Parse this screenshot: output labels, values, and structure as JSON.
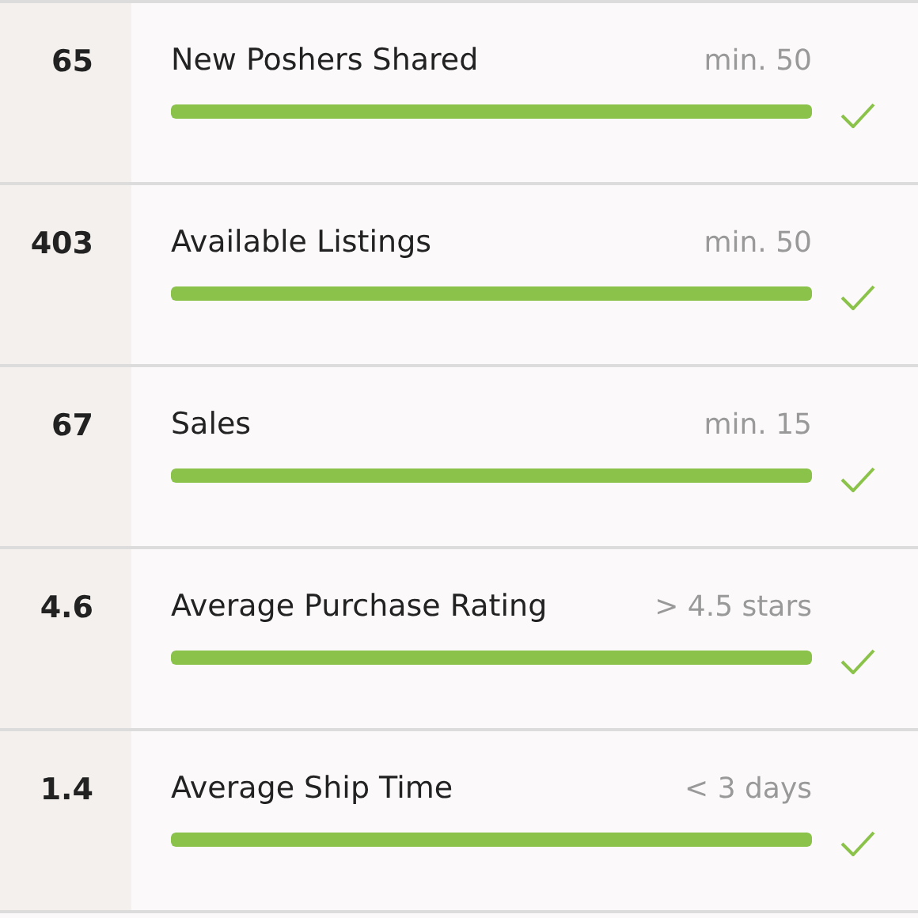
{
  "requirements": [
    {
      "value": "65",
      "label": "New Poshers Shared",
      "target": "min. 50",
      "level": 1,
      "met": true
    },
    {
      "value": "403",
      "label": "Available Listings",
      "target": "min. 50",
      "level": 1,
      "met": true
    },
    {
      "value": "67",
      "label": "Sales",
      "target": "min. 15",
      "level": 1,
      "met": true
    },
    {
      "value": "4.6",
      "label": "Average Purchase Rating",
      "target": "> 4.5 stars",
      "level": 1,
      "met": true
    },
    {
      "value": "1.4",
      "label": "Average Ship Time",
      "target": "< 3 days",
      "level": 1,
      "met": true
    }
  ]
}
